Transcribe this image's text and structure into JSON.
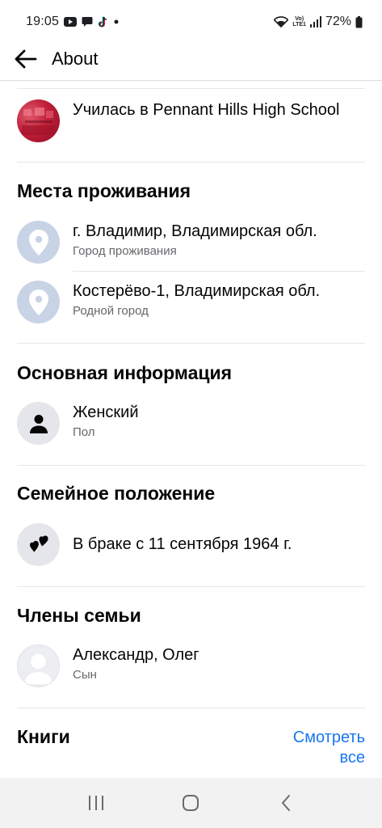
{
  "status_bar": {
    "time": "19:05",
    "volte_line1": "Vo)",
    "volte_line2": "LTE1",
    "battery": "72%",
    "left_icons": [
      "youtube-icon",
      "message-icon",
      "tiktok-icon",
      "dot-icon"
    ],
    "right_icons": [
      "wifi-icon",
      "signal-icon",
      "battery-icon"
    ]
  },
  "header": {
    "title": "About",
    "back_icon": "arrow-left-icon"
  },
  "education": {
    "text": "Училась в Pennant Hills High School"
  },
  "places": {
    "title": "Места проживания",
    "items": [
      {
        "primary": "г. Владимир, Владимирская обл.",
        "secondary": "Город проживания",
        "icon": "location-pin-icon"
      },
      {
        "primary": "Костерёво-1, Владимирская обл.",
        "secondary": "Родной город",
        "icon": "location-pin-icon"
      }
    ]
  },
  "basic_info": {
    "title": "Основная информация",
    "items": [
      {
        "primary": "Женский",
        "secondary": "Пол",
        "icon": "person-icon"
      }
    ]
  },
  "relationship": {
    "title": "Семейное положение",
    "items": [
      {
        "primary": "В браке с 11 сентября 1964 г.",
        "icon": "hearts-icon"
      }
    ]
  },
  "family": {
    "title": "Члены семьи",
    "items": [
      {
        "primary": "Александр, Олег",
        "secondary": "Сын",
        "icon": "default-avatar-icon"
      }
    ]
  },
  "books": {
    "title": "Книги",
    "see_all_line1": "Смотреть",
    "see_all_line2": "все"
  },
  "nav": {
    "icons": [
      "recent-apps-icon",
      "home-icon",
      "back-icon"
    ]
  },
  "colors": {
    "accent": "#1877f2",
    "text_primary": "#050505",
    "text_secondary": "#65676b",
    "pin_bg": "#c8d3e6",
    "divider": "#e4e6eb"
  }
}
